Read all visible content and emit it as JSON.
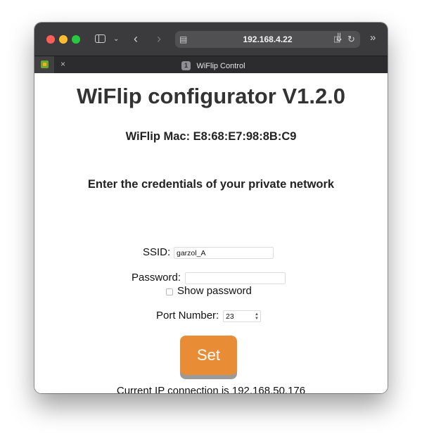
{
  "browser": {
    "address": "192.168.4.22",
    "tab_number": "1",
    "tab_title": "WiFlip Control",
    "tab_close_glyph": "×",
    "icons": [
      "sidebar-icon",
      "chevron-down-icon",
      "back-icon",
      "forward-icon",
      "site-settings-icon",
      "translate-icon",
      "reload-icon",
      "download-icon",
      "more-chevrons-icon",
      "favicon",
      "close-icon"
    ]
  },
  "page": {
    "title": "WiFlip configurator V1.2.0",
    "mac_line": "WiFlip Mac: E8:68:E7:98:8B:C9",
    "credentials_heading": "Enter the credentials of your private network",
    "ssid_label": "SSID:",
    "ssid_value": "garzol_A",
    "password_label": "Password:",
    "password_value": "",
    "show_password_label": "Show password",
    "show_password_checked": false,
    "port_label": "Port Number:",
    "port_value": "23",
    "set_button_label": "Set",
    "ip_line": "Current IP connection is 192.168.50.176"
  },
  "colors": {
    "set_button": "#e88c35",
    "toolbar": "#3b3b3d",
    "tabbar": "#2c2c2e"
  }
}
